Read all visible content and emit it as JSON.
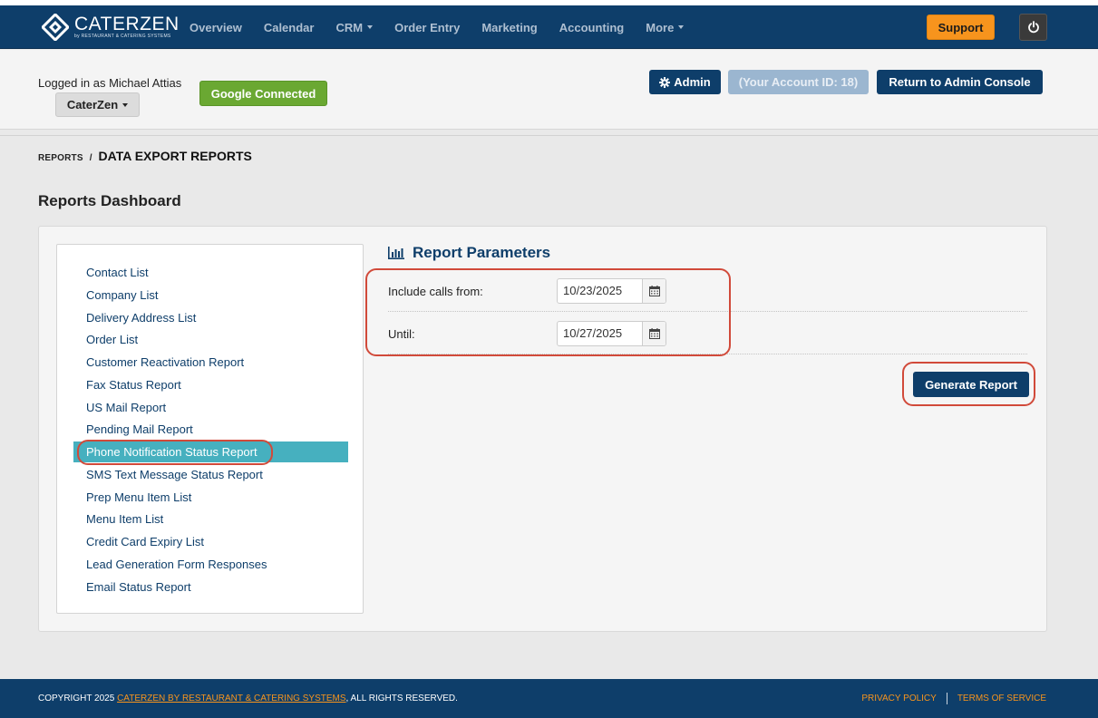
{
  "brand": {
    "name": "CATERZEN",
    "sub": "by RESTAURANT & CATERING SYSTEMS"
  },
  "nav": {
    "items": [
      {
        "label": "Overview",
        "dropdown": false
      },
      {
        "label": "Calendar",
        "dropdown": false
      },
      {
        "label": "CRM",
        "dropdown": true
      },
      {
        "label": "Order Entry",
        "dropdown": false
      },
      {
        "label": "Marketing",
        "dropdown": false
      },
      {
        "label": "Accounting",
        "dropdown": false
      },
      {
        "label": "More",
        "dropdown": true
      }
    ],
    "support_label": "Support"
  },
  "header": {
    "logged_in": "Logged in as Michael Attias",
    "company_label": "CaterZen",
    "google_label": "Google Connected",
    "admin_label": "Admin",
    "account_label": "(Your Account ID: 18)",
    "return_label": "Return to Admin Console"
  },
  "breadcrumb": {
    "parent": "REPORTS",
    "separator": "/",
    "current": "DATA EXPORT REPORTS"
  },
  "page_title": "Reports Dashboard",
  "reports": [
    "Contact List",
    "Company List",
    "Delivery Address List",
    "Order List",
    "Customer Reactivation Report",
    "Fax Status Report",
    "US Mail Report",
    "Pending Mail Report",
    "Phone Notification Status Report",
    "SMS Text Message Status Report",
    "Prep Menu Item List",
    "Menu Item List",
    "Credit Card Expiry List",
    "Lead Generation Form Responses",
    "Email Status Report"
  ],
  "active_report": "Phone Notification Status Report",
  "params": {
    "title": "Report Parameters",
    "from_label": "Include calls from:",
    "from_value": "10/23/2025",
    "until_label": "Until:",
    "until_value": "10/27/2025",
    "generate_label": "Generate Report"
  },
  "footer": {
    "copyright_prefix": "COPYRIGHT 2025 ",
    "company_link": "CATERZEN BY RESTAURANT & CATERING SYSTEMS",
    "copyright_suffix": ", ALL RIGHTS RESERVED.",
    "privacy": "PRIVACY POLICY",
    "terms": "TERMS OF SERVICE"
  },
  "colors": {
    "nav_bg": "#0e3e6a",
    "accent": "#f7941d",
    "active_item": "#46b0bf",
    "google": "#6aa832",
    "highlight": "#d14a3a"
  },
  "icons": {
    "logo": "caterzen-logo-icon",
    "power": "power-icon",
    "admin": "gear-icon",
    "params": "bar-chart-icon",
    "date": "calendar-icon"
  }
}
